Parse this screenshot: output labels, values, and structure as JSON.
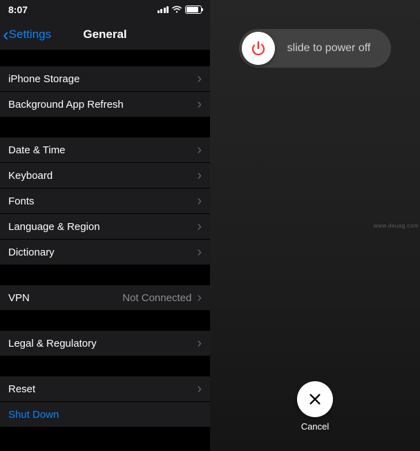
{
  "status": {
    "time": "8:07"
  },
  "nav": {
    "back_label": "Settings",
    "title": "General"
  },
  "rows": {
    "storage": "iPhone Storage",
    "bgrefresh": "Background App Refresh",
    "datetime": "Date & Time",
    "keyboard": "Keyboard",
    "fonts": "Fonts",
    "langregion": "Language & Region",
    "dictionary": "Dictionary",
    "vpn": "VPN",
    "vpn_detail": "Not Connected",
    "legal": "Legal & Regulatory",
    "reset": "Reset",
    "shutdown": "Shut Down"
  },
  "poweroff": {
    "slide_text": "slide to power off",
    "cancel_label": "Cancel"
  },
  "colors": {
    "accent": "#0a84ff",
    "power_red": "#ff2d2d"
  },
  "watermark": "www.deuag.com"
}
